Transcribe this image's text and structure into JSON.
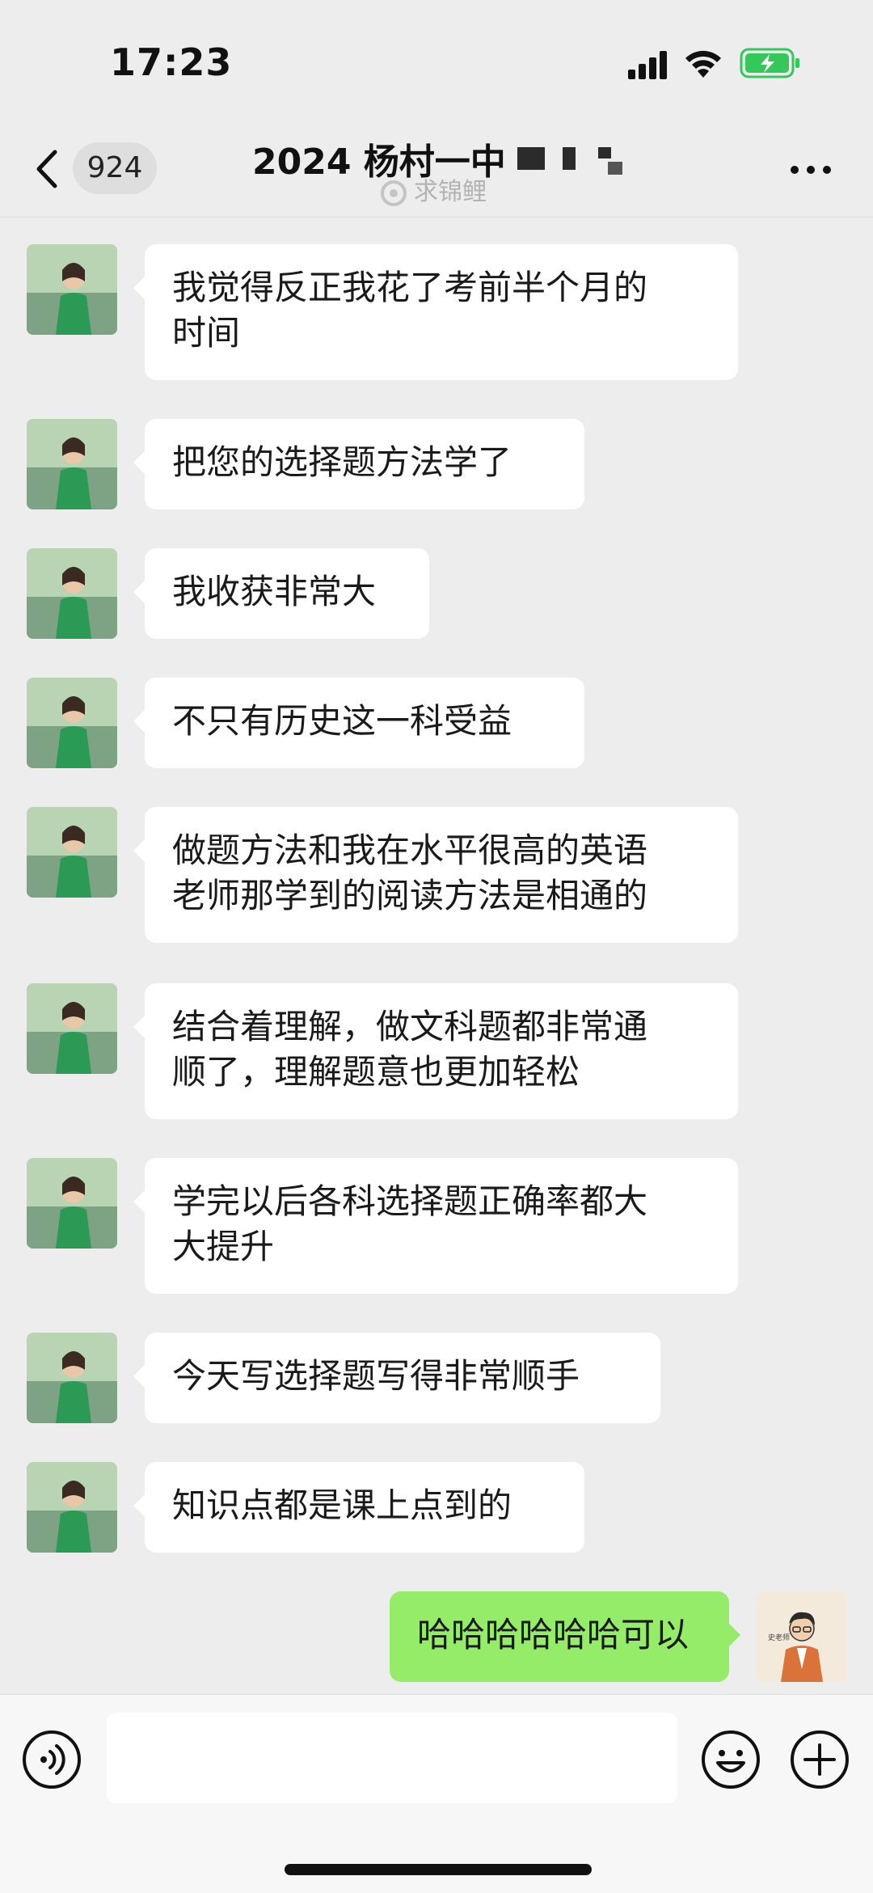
{
  "status_bar": {
    "time": "17:23",
    "icons": [
      "signal-icon",
      "wifi-icon",
      "battery-charging-icon"
    ]
  },
  "header": {
    "back_icon": "chevron-left-icon",
    "unread_count": "924",
    "title": "2024 杨村一中",
    "watermark": "求锦鲤",
    "more_icon": "more-icon"
  },
  "messages": [
    {
      "sender": "other",
      "text": "我觉得反正我花了考前半个月的\n时间"
    },
    {
      "sender": "other",
      "text": "把您的选择题方法学了"
    },
    {
      "sender": "other",
      "text": "我收获非常大"
    },
    {
      "sender": "other",
      "text": "不只有历史这一科受益"
    },
    {
      "sender": "other",
      "text": "做题方法和我在水平很高的英语\n老师那学到的阅读方法是相通的"
    },
    {
      "sender": "other",
      "text": "结合着理解，做文科题都非常通\n顺了，理解题意也更加轻松"
    },
    {
      "sender": "other",
      "text": "学完以后各科选择题正确率都大\n大提升"
    },
    {
      "sender": "other",
      "text": "今天写选择题写得非常顺手"
    },
    {
      "sender": "other",
      "text": "知识点都是课上点到的"
    },
    {
      "sender": "me",
      "text": "哈哈哈哈哈哈可以"
    }
  ],
  "my_avatar": {
    "label": "史老师"
  },
  "input_bar": {
    "value": "",
    "placeholder": "",
    "icons": [
      "voice-icon",
      "emoji-icon",
      "plus-icon"
    ]
  },
  "colors": {
    "background": "#ededed",
    "bubble_other": "#ffffff",
    "bubble_me": "#95ec69",
    "battery_green": "#34c759"
  }
}
